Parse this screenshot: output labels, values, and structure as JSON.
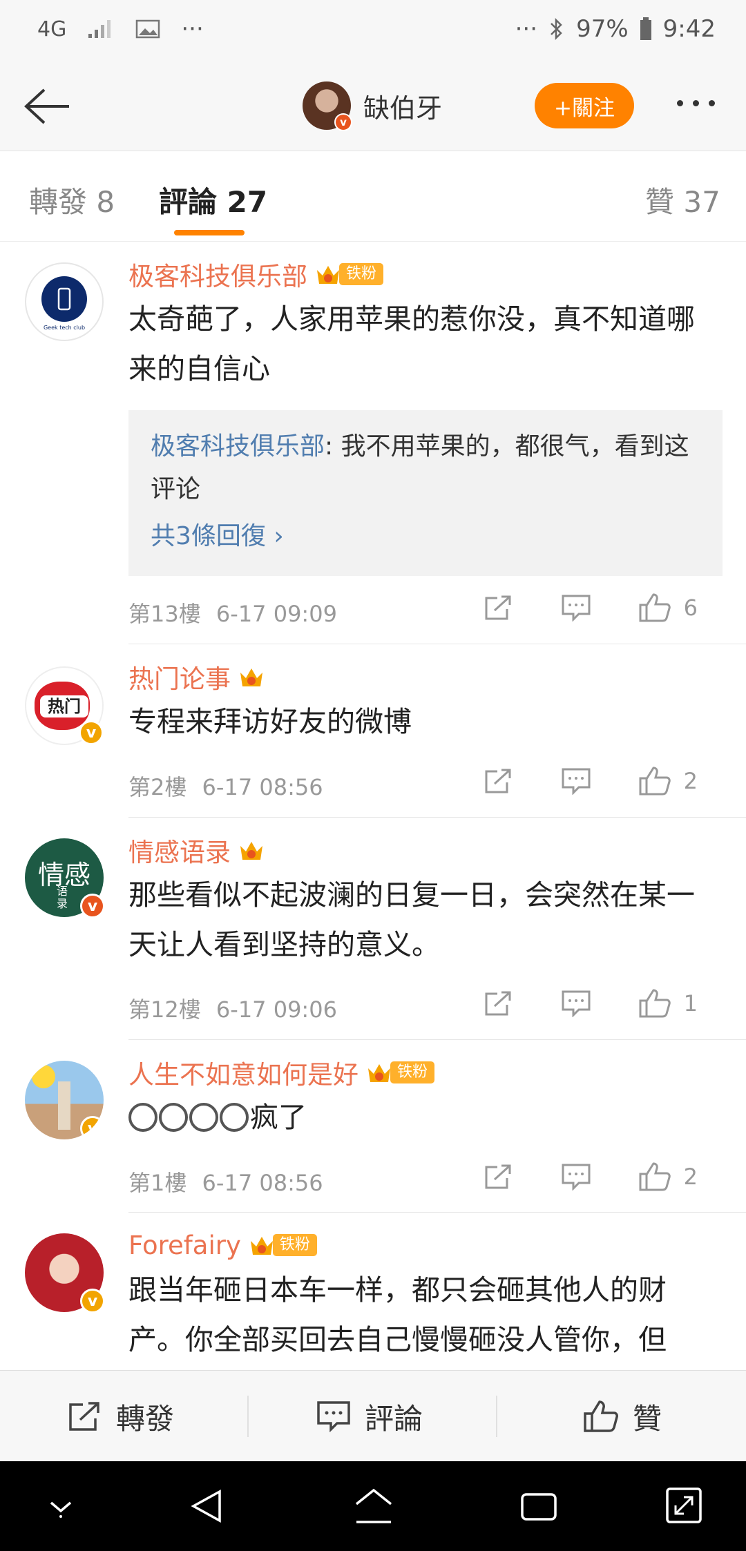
{
  "status_bar": {
    "network": "4G",
    "dots_left": "···",
    "dots_right": "···",
    "battery": "97%",
    "time": "9:42"
  },
  "nav": {
    "username": "缺伯牙",
    "follow_label": "+關注"
  },
  "tabs": [
    {
      "label": "轉發 8"
    },
    {
      "label": "評論 27"
    },
    {
      "label": "贊 37"
    }
  ],
  "comments": [
    {
      "name": "极客科技俱乐部",
      "fan_badge": "铁粉",
      "avatar_text": "Geek tech club",
      "text": "太奇葩了，人家用苹果的惹你没，真不知道哪来的自信心",
      "reply": {
        "name": "极客科技俱乐部",
        "text": ": 我不用苹果的，都很气，看到这评论",
        "more": "共3條回復 ›"
      },
      "floor": "第13樓",
      "time": "6-17 09:09",
      "likes": "6"
    },
    {
      "name": "热门论事",
      "avatar_text": "热门",
      "text": "专程来拜访好友的微博",
      "floor": "第2樓",
      "time": "6-17 08:56",
      "likes": "2"
    },
    {
      "name": "情感语录",
      "avatar_text": "情感",
      "avatar_sub": "语录",
      "text": "那些看似不起波澜的日复一日，会突然在某一天让人看到坚持的意义。",
      "floor": "第12樓",
      "time": "6-17 09:06",
      "likes": "1"
    },
    {
      "name": "人生不如意如何是好",
      "fan_badge": "铁粉",
      "text_suffix": "疯了",
      "floor": "第1樓",
      "time": "6-17 08:56",
      "likes": "2"
    },
    {
      "name": "Forefairy",
      "fan_badge": "铁粉",
      "text": "跟当年砸日本车一样，都只会砸其他人的财产。你全部买回去自己慢慢砸没人管你，但"
    }
  ],
  "bottom_bar": {
    "repost": "轉發",
    "comment": "評論",
    "like": "贊"
  },
  "colors": {
    "accent": "#ff8200",
    "name": "#eb7350",
    "link": "#507daf"
  }
}
